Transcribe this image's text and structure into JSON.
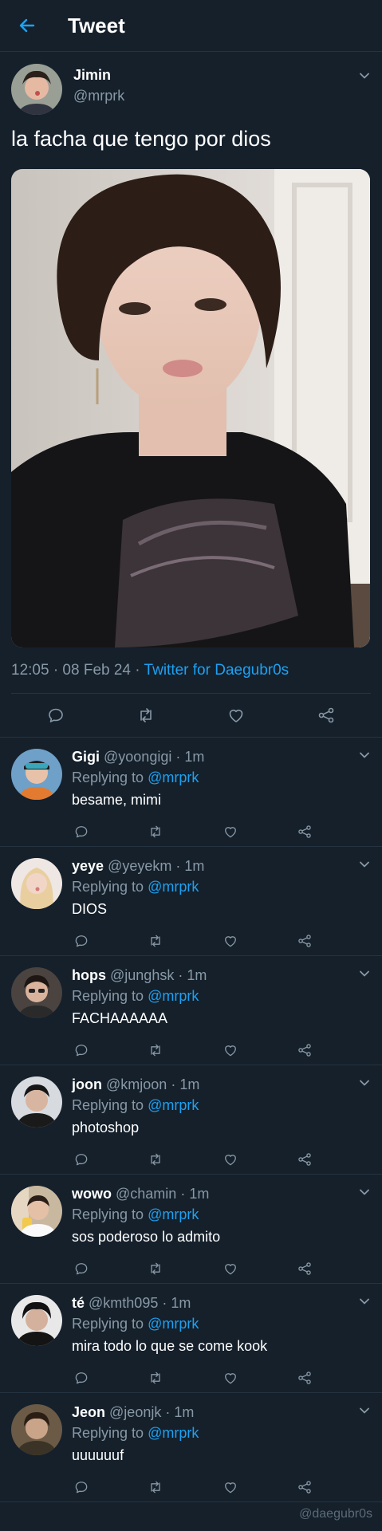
{
  "header": {
    "title": "Tweet"
  },
  "tweet": {
    "author_name": "Jimin",
    "author_handle": "@mrprk",
    "text": "la facha que tengo por dios",
    "time": "12:05 · 08 Feb 24 · ",
    "source": "Twitter for Daegubr0s"
  },
  "colors": {
    "background": "#15202b",
    "accent": "#1da1f2",
    "muted": "#8899a6",
    "divider": "#253341"
  },
  "icons": {
    "back": "arrow-left-icon",
    "more": "chevron-down-icon",
    "reply": "comment-icon",
    "retweet": "retweet-icon",
    "like": "heart-icon",
    "share": "share-icon"
  },
  "replying_label": "Replying to ",
  "replies": [
    {
      "name": "Gigi",
      "handle": "@yoongigi",
      "time": " · 1m",
      "mention": "@mrprk",
      "text": "besame, mimi"
    },
    {
      "name": "yeye",
      "handle": "@yeyekm",
      "time": " · 1m",
      "mention": "@mrprk",
      "text": "DIOS"
    },
    {
      "name": "hops",
      "handle": "@junghsk",
      "time": " · 1m",
      "mention": "@mrprk",
      "text": "FACHAAAAAA"
    },
    {
      "name": "joon",
      "handle": "@kmjoon",
      "time": " · 1m",
      "mention": "@mrprk",
      "text": "photoshop"
    },
    {
      "name": "wowo",
      "handle": "@chamin",
      "time": " · 1m",
      "mention": "@mrprk",
      "text": "sos poderoso lo admito"
    },
    {
      "name": "té",
      "handle": "@kmth095",
      "time": " · 1m",
      "mention": "@mrprk",
      "text": "mira todo lo que se come kook"
    },
    {
      "name": "Jeon",
      "handle": "@jeonjk",
      "time": " · 1m",
      "mention": "@mrprk",
      "text": "uuuuuuf"
    }
  ],
  "watermark": "@daegubr0s"
}
